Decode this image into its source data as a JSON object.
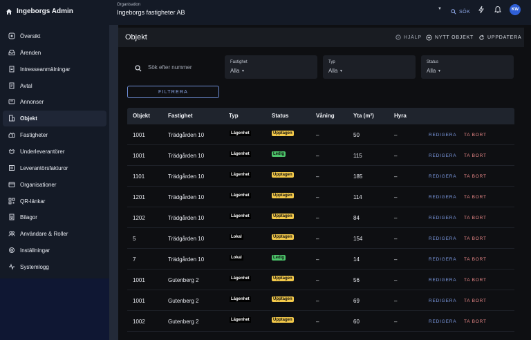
{
  "app": {
    "title": "Ingeborgs Admin"
  },
  "org": {
    "label": "Organisation",
    "value": "Ingeborgs fastigheter AB"
  },
  "topbar": {
    "search_label": "SÖK",
    "avatar_initials": "KW"
  },
  "sidebar": {
    "items": [
      {
        "label": "Översikt",
        "icon": "dashboard-icon"
      },
      {
        "label": "Ärenden",
        "icon": "inbox-icon"
      },
      {
        "label": "Intresseanmälningar",
        "icon": "document-icon"
      },
      {
        "label": "Avtal",
        "icon": "contract-icon"
      },
      {
        "label": "Annonser",
        "icon": "megaphone-icon"
      },
      {
        "label": "Objekt",
        "icon": "building-icon",
        "active": true
      },
      {
        "label": "Fastigheter",
        "icon": "houses-icon"
      },
      {
        "label": "Underleverantörer",
        "icon": "handshake-icon"
      },
      {
        "label": "Leverantörsfakturor",
        "icon": "invoice-icon"
      },
      {
        "label": "Organisationer",
        "icon": "organization-icon"
      },
      {
        "label": "QR-länkar",
        "icon": "qr-icon"
      },
      {
        "label": "Bilagor",
        "icon": "attachment-icon"
      },
      {
        "label": "Användare & Roller",
        "icon": "users-icon"
      },
      {
        "label": "Inställningar",
        "icon": "settings-icon"
      },
      {
        "label": "Systemlogg",
        "icon": "activity-icon"
      }
    ]
  },
  "page": {
    "title": "Objekt",
    "help_label": "HJÄLP",
    "new_label": "NYTT OBJEKT",
    "refresh_label": "UPPDATERA"
  },
  "filters": {
    "search_placeholder": "Sök efter nummer",
    "fastighet": {
      "label": "Fastighet",
      "value": "Alla"
    },
    "typ": {
      "label": "Typ",
      "value": "Alla"
    },
    "status": {
      "label": "Status",
      "value": "Alla"
    },
    "filter_label": "FILTRERA"
  },
  "table": {
    "headers": [
      "Objekt",
      "Fastighet",
      "Typ",
      "Status",
      "Våning",
      "Yta (m²)",
      "Hyra"
    ],
    "edit_label": "REDIGERA",
    "delete_label": "TA BORT",
    "rows": [
      {
        "objekt": "1001",
        "fastighet": "Trädgården 10",
        "typ": "Lägenhet",
        "status": "Upptagen",
        "vaning": "–",
        "yta": "50",
        "hyra": "–"
      },
      {
        "objekt": "1001",
        "fastighet": "Trädgården 10",
        "typ": "Lägenhet",
        "status": "Ledig",
        "vaning": "–",
        "yta": "115",
        "hyra": "–"
      },
      {
        "objekt": "1101",
        "fastighet": "Trädgården 10",
        "typ": "Lägenhet",
        "status": "Upptagen",
        "vaning": "–",
        "yta": "185",
        "hyra": "–"
      },
      {
        "objekt": "1201",
        "fastighet": "Trädgården 10",
        "typ": "Lägenhet",
        "status": "Upptagen",
        "vaning": "–",
        "yta": "114",
        "hyra": "–"
      },
      {
        "objekt": "1202",
        "fastighet": "Trädgården 10",
        "typ": "Lägenhet",
        "status": "Upptagen",
        "vaning": "–",
        "yta": "84",
        "hyra": "–"
      },
      {
        "objekt": "5",
        "fastighet": "Trädgården 10",
        "typ": "Lokal",
        "status": "Upptagen",
        "vaning": "–",
        "yta": "154",
        "hyra": "–"
      },
      {
        "objekt": "7",
        "fastighet": "Trädgården 10",
        "typ": "Lokal",
        "status": "Ledig",
        "vaning": "–",
        "yta": "14",
        "hyra": "–"
      },
      {
        "objekt": "1001",
        "fastighet": "Gutenberg 2",
        "typ": "Lägenhet",
        "status": "Upptagen",
        "vaning": "–",
        "yta": "56",
        "hyra": "–"
      },
      {
        "objekt": "1001",
        "fastighet": "Gutenberg 2",
        "typ": "Lägenhet",
        "status": "Upptagen",
        "vaning": "–",
        "yta": "69",
        "hyra": "–"
      },
      {
        "objekt": "1002",
        "fastighet": "Gutenberg 2",
        "typ": "Lägenhet",
        "status": "Upptagen",
        "vaning": "–",
        "yta": "60",
        "hyra": "–"
      }
    ]
  },
  "colors": {
    "upptagen": "#f3c94a",
    "ledig": "#4cc46a"
  }
}
